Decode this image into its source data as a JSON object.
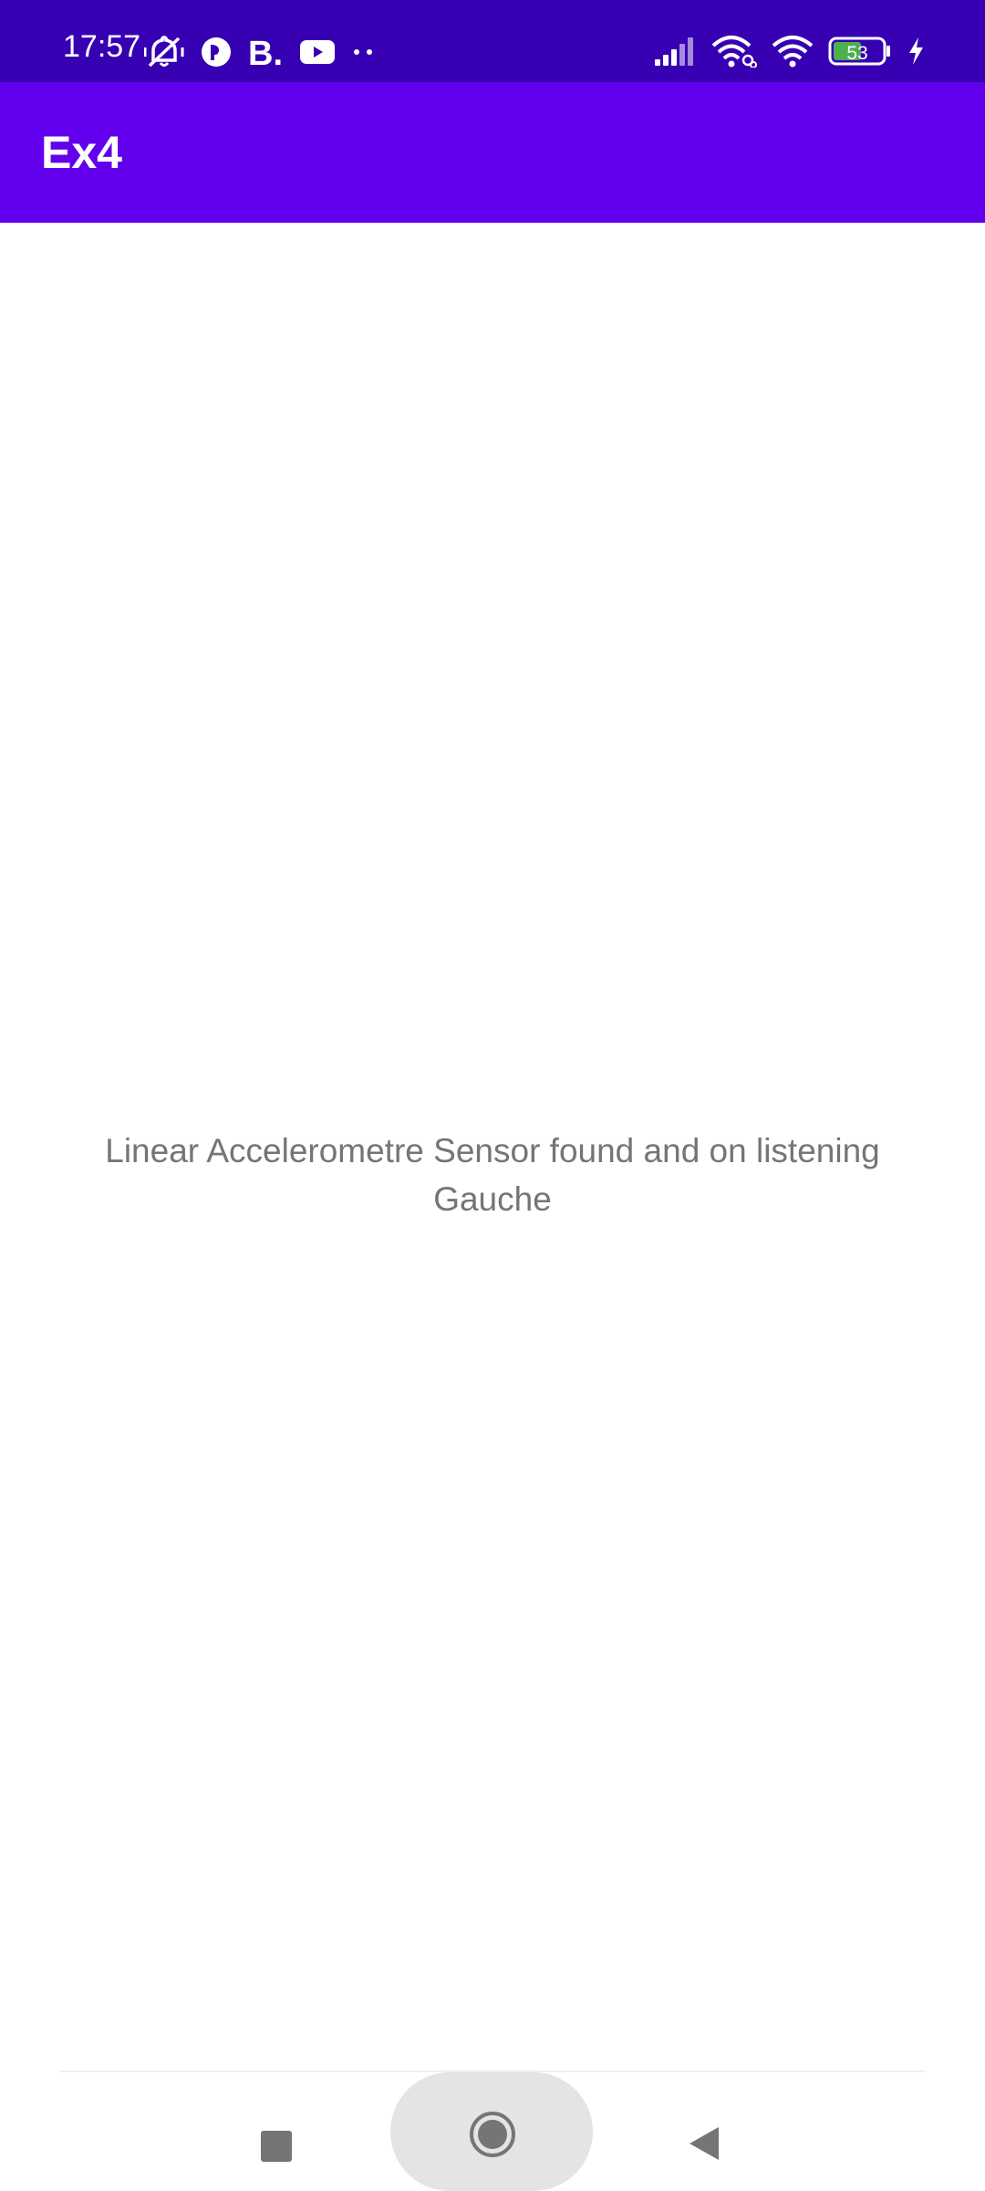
{
  "status_bar": {
    "time": "17:57",
    "battery_level": "53",
    "icons": [
      "bell-off-icon",
      "app-icon",
      "b-icon",
      "youtube-icon",
      "more-dots-icon",
      "signal-icon",
      "wifi-link-icon",
      "wifi-icon",
      "battery-icon",
      "charging-icon"
    ],
    "background_color": "#3700b3"
  },
  "app_bar": {
    "title": "Ex4",
    "background_color": "#6200ee"
  },
  "main": {
    "message_line1": "Linear Accelerometre Sensor found and on listening",
    "message_line2": "Gauche",
    "text_color": "#757575"
  },
  "nav_bar": {
    "icons": [
      "recents-icon",
      "home-icon",
      "back-icon"
    ]
  }
}
